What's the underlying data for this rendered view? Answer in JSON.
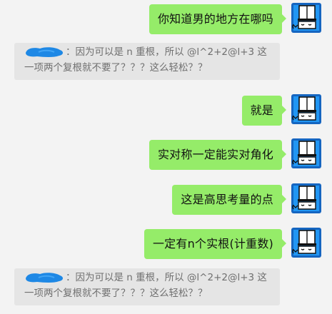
{
  "messages": [
    {
      "type": "outgoing",
      "text": "你知道男的地方在哪吗"
    },
    {
      "type": "quote",
      "text_line1": "：因为可以是 n 重根，所以 @l^2+2@l+3 这",
      "text_line2": "一项两个复根就不要了？？？这么轻松？？"
    },
    {
      "type": "outgoing",
      "text": "就是"
    },
    {
      "type": "outgoing",
      "text": "实对称一定能实对角化"
    },
    {
      "type": "outgoing",
      "text": "这是高思考量的点"
    },
    {
      "type": "outgoing",
      "text": "一定有n个实根(计重数)"
    },
    {
      "type": "quote",
      "text_line1": "：因为可以是 n 重根，所以 @l^2+2@l+3 这",
      "text_line2": "一项两个复根就不要了？？？这么轻松？？"
    }
  ],
  "colors": {
    "outgoing_bubble": "#95ec69",
    "quote_bg": "#e5e5e5",
    "page_bg": "#f3f3f3",
    "redaction_blob": "#1e88e5"
  }
}
